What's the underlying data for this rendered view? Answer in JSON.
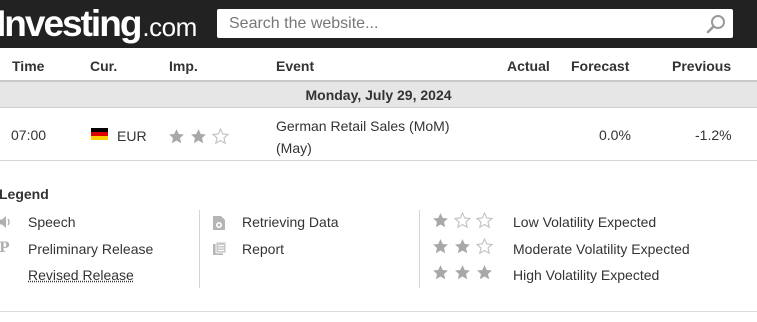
{
  "header": {
    "logo_brand": "Investing",
    "logo_suffix": ".com",
    "search_placeholder": "Search the website...",
    "background_color": "#222222"
  },
  "table": {
    "columns": [
      "Time",
      "Cur.",
      "Imp.",
      "Event",
      "Actual",
      "Forecast",
      "Previous"
    ],
    "date_label": "Monday, July 29, 2024",
    "rows": [
      {
        "time": "07:00",
        "currency": "EUR",
        "flag": "germany-flag",
        "importance": 2,
        "event_line1": "German Retail Sales (MoM)",
        "event_line2": "(May)",
        "actual": "",
        "forecast": "0.0%",
        "previous": "-1.2%"
      }
    ]
  },
  "legend": {
    "title": "Legend",
    "col1": [
      {
        "icon": "speaker-icon",
        "label": "Speech"
      },
      {
        "icon": "preliminary-p-icon",
        "label": "Preliminary Release"
      },
      {
        "icon": "",
        "label": "Revised Release"
      }
    ],
    "col2": [
      {
        "icon": "retrieving-data-icon",
        "label": "Retrieving Data"
      },
      {
        "icon": "report-icon",
        "label": "Report"
      }
    ],
    "col3": [
      {
        "stars": 1,
        "label": "Low Volatility Expected"
      },
      {
        "stars": 2,
        "label": "Moderate Volatility Expected"
      },
      {
        "stars": 3,
        "label": "High Volatility Expected"
      }
    ]
  },
  "colors": {
    "star_filled": "#a8a8a8",
    "star_empty": "#c4c4c4",
    "flag_black": "#000000",
    "flag_red": "#dd0000",
    "flag_gold": "#ffce00"
  }
}
